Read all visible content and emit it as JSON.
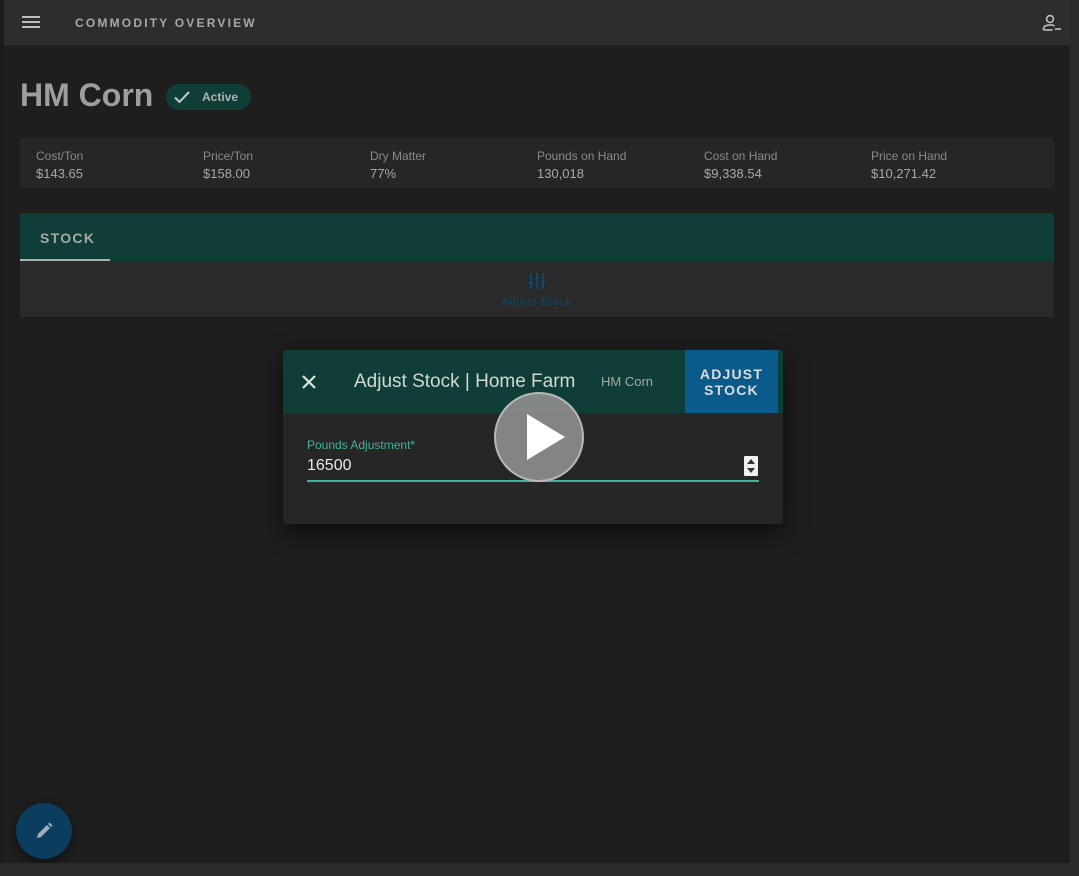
{
  "appbar": {
    "title": "COMMODITY OVERVIEW",
    "menu_icon": "menu-icon",
    "account_icon": "account-icon"
  },
  "commodity": {
    "name": "HM Corn",
    "status": "Active"
  },
  "stats": [
    {
      "label": "Cost/Ton",
      "value": "$143.65"
    },
    {
      "label": "Price/Ton",
      "value": "$158.00"
    },
    {
      "label": "Dry Matter",
      "value": "77%"
    },
    {
      "label": "Pounds on Hand",
      "value": "130,018"
    },
    {
      "label": "Cost on Hand",
      "value": "$9,338.54"
    },
    {
      "label": "Price on Hand",
      "value": "$10,271.42"
    }
  ],
  "tabs": [
    {
      "label": "STOCK",
      "active": true
    }
  ],
  "stock_panel": {
    "action_label": "Adjust Stock",
    "action_icon": "sliders-icon"
  },
  "dialog": {
    "title": "Adjust Stock | Home Farm",
    "subtitle": "HM Corn",
    "action_label": "ADJUST\nSTOCK",
    "field_label": "Pounds Adjustment*",
    "field_value": "16500"
  },
  "colors": {
    "teal_bar": "#0f3e38",
    "accent": "#3fb39e",
    "action_blue": "#0a5a8c"
  }
}
